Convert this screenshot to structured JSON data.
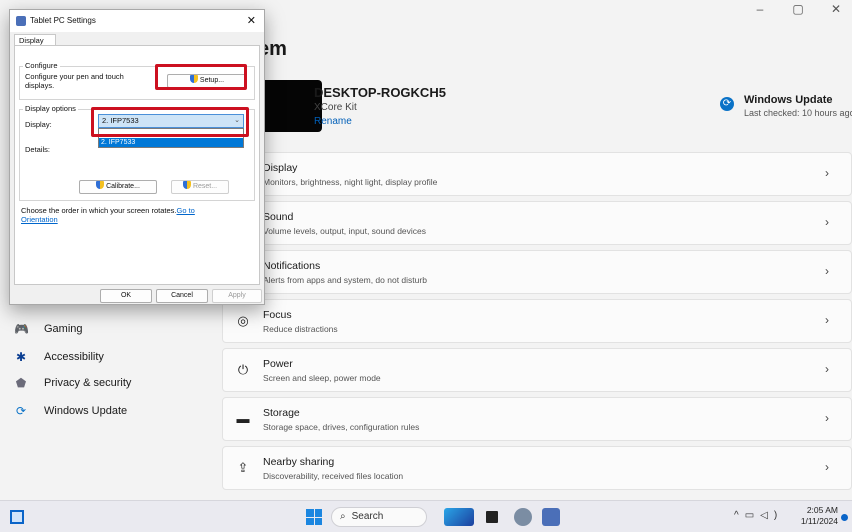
{
  "settings": {
    "window_controls": [
      "–",
      "▢",
      "✕"
    ],
    "page_title_fragment": "em",
    "device": {
      "name": "DESKTOP-ROGKCH5",
      "model": "XCore Kit",
      "rename": "Rename"
    },
    "windows_update": {
      "title": "Windows Update",
      "subtitle": "Last checked: 10 hours ago"
    },
    "nav": [
      {
        "label": "Gaming",
        "icon": "gaming-icon"
      },
      {
        "label": "Accessibility",
        "icon": "accessibility-icon"
      },
      {
        "label": "Privacy & security",
        "icon": "shield-icon"
      },
      {
        "label": "Windows Update",
        "icon": "update-icon"
      }
    ],
    "cards": [
      {
        "title": "Display",
        "subtitle": "Monitors, brightness, night light, display profile",
        "icon": "display-icon"
      },
      {
        "title": "Sound",
        "subtitle": "Volume levels, output, input, sound devices",
        "icon": "sound-icon"
      },
      {
        "title": "Notifications",
        "subtitle": "Alerts from apps and system, do not disturb",
        "icon": "bell-icon"
      },
      {
        "title": "Focus",
        "subtitle": "Reduce distractions",
        "icon": "focus-icon"
      },
      {
        "title": "Power",
        "subtitle": "Screen and sleep, power mode",
        "icon": "power-icon"
      },
      {
        "title": "Storage",
        "subtitle": "Storage space, drives, configuration rules",
        "icon": "storage-icon"
      },
      {
        "title": "Nearby sharing",
        "subtitle": "Discoverability, received files location",
        "icon": "share-icon"
      }
    ]
  },
  "dialog": {
    "title": "Tablet PC Settings",
    "tab": "Display",
    "configure_group": "Configure",
    "configure_text": "Configure your pen and touch displays.",
    "setup_button": "Setup...",
    "display_options_group": "Display options",
    "display_label": "Display:",
    "display_value": "2. IFP7533",
    "display_option_highlighted": "2. IFP7533",
    "details_label": "Details:",
    "calibrate_button": "Calibrate...",
    "reset_button": "Reset...",
    "orientation_text": "Choose the order in which your screen rotates.",
    "orientation_link": "Go to Orientation",
    "ok_button": "OK",
    "cancel_button": "Cancel",
    "apply_button": "Apply"
  },
  "taskbar": {
    "search_label": "Search",
    "time": "2:05 AM",
    "date": "1/11/2024"
  },
  "colors": {
    "accent": "#005fb8",
    "highlight_box": "#cc1020",
    "selection": "#0078d7"
  }
}
